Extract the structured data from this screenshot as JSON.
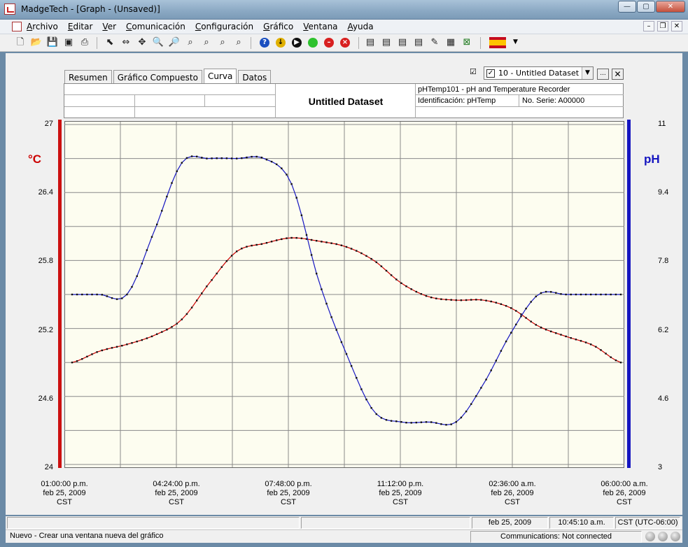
{
  "window": {
    "title": "MadgeTech - [Graph - (Unsaved)]"
  },
  "menu": [
    "Archivo",
    "Editar",
    "Ver",
    "Comunicación",
    "Configuración",
    "Gráfico",
    "Ventana",
    "Ayuda"
  ],
  "tabs": [
    "Resumen",
    "Gráfico Compuesto",
    "Curva",
    "Datos"
  ],
  "active_tab": "Curva",
  "dataset_select": {
    "label": "10 - Untitled Dataset",
    "more": "...",
    "close": "✕"
  },
  "header": {
    "title": "Untitled Dataset",
    "device": "pHTemp101 - pH and Temperature Recorder",
    "identification": "Identificación: pHTemp",
    "serial": "No. Serie: A00000"
  },
  "colors": {
    "temp": "#cc0000",
    "ph": "#1515c0",
    "plot_bg": "#fdfdf0"
  },
  "chart_data": {
    "type": "line",
    "left_axis": {
      "label": "°C",
      "ticks": [
        "27",
        "26.4",
        "25.8",
        "25.2",
        "24.6",
        "24"
      ],
      "range": [
        24,
        27
      ]
    },
    "right_axis": {
      "label": "pH",
      "ticks": [
        "11",
        "9.4",
        "7.8",
        "6.2",
        "4.6",
        "3"
      ],
      "range": [
        3,
        11
      ]
    },
    "x_ticks": [
      {
        "time": "01:00:00 p.m.",
        "date": "feb 25, 2009",
        "tz": "CST"
      },
      {
        "time": "04:24:00 p.m.",
        "date": "feb 25, 2009",
        "tz": "CST"
      },
      {
        "time": "07:48:00 p.m.",
        "date": "feb 25, 2009",
        "tz": "CST"
      },
      {
        "time": "11:12:00 p.m.",
        "date": "feb 25, 2009",
        "tz": "CST"
      },
      {
        "time": "02:36:00 a.m.",
        "date": "feb 26, 2009",
        "tz": "CST"
      },
      {
        "time": "06:00:00 a.m.",
        "date": "feb 26, 2009",
        "tz": "CST"
      }
    ],
    "grid": true,
    "x_hours": [
      0,
      0.85,
      1.7,
      2.55,
      3.4,
      4.25,
      5.1,
      5.95,
      6.8,
      7.65,
      8.5,
      9.35,
      10.2,
      11.05,
      11.9,
      12.75,
      13.6,
      14.45,
      15.3,
      16.15,
      17
    ],
    "series": [
      {
        "name": "°C",
        "axis": "left",
        "values": [
          24.9,
          25.0,
          25.06,
          25.14,
          25.28,
          25.6,
          25.88,
          25.95,
          26.0,
          25.97,
          25.92,
          25.8,
          25.6,
          25.48,
          25.45,
          25.45,
          25.38,
          25.22,
          25.13,
          25.05,
          24.9
        ]
      },
      {
        "name": "pH",
        "axis": "left_ph",
        "values": [
          7.0,
          7.0,
          7.0,
          8.5,
          10.1,
          10.2,
          10.2,
          10.2,
          9.6,
          7.3,
          5.6,
          4.25,
          4.0,
          4.0,
          4.0,
          4.9,
          6.1,
          7.0,
          7.0,
          7.0,
          7.0
        ]
      }
    ]
  },
  "status": {
    "date": "feb 25, 2009",
    "time": "10:45:10 a.m.",
    "tz": "CST (UTC-06:00)",
    "hint": "Nuevo - Crear una ventana nueva del gráfico",
    "comms": "Communications: Not connected"
  }
}
